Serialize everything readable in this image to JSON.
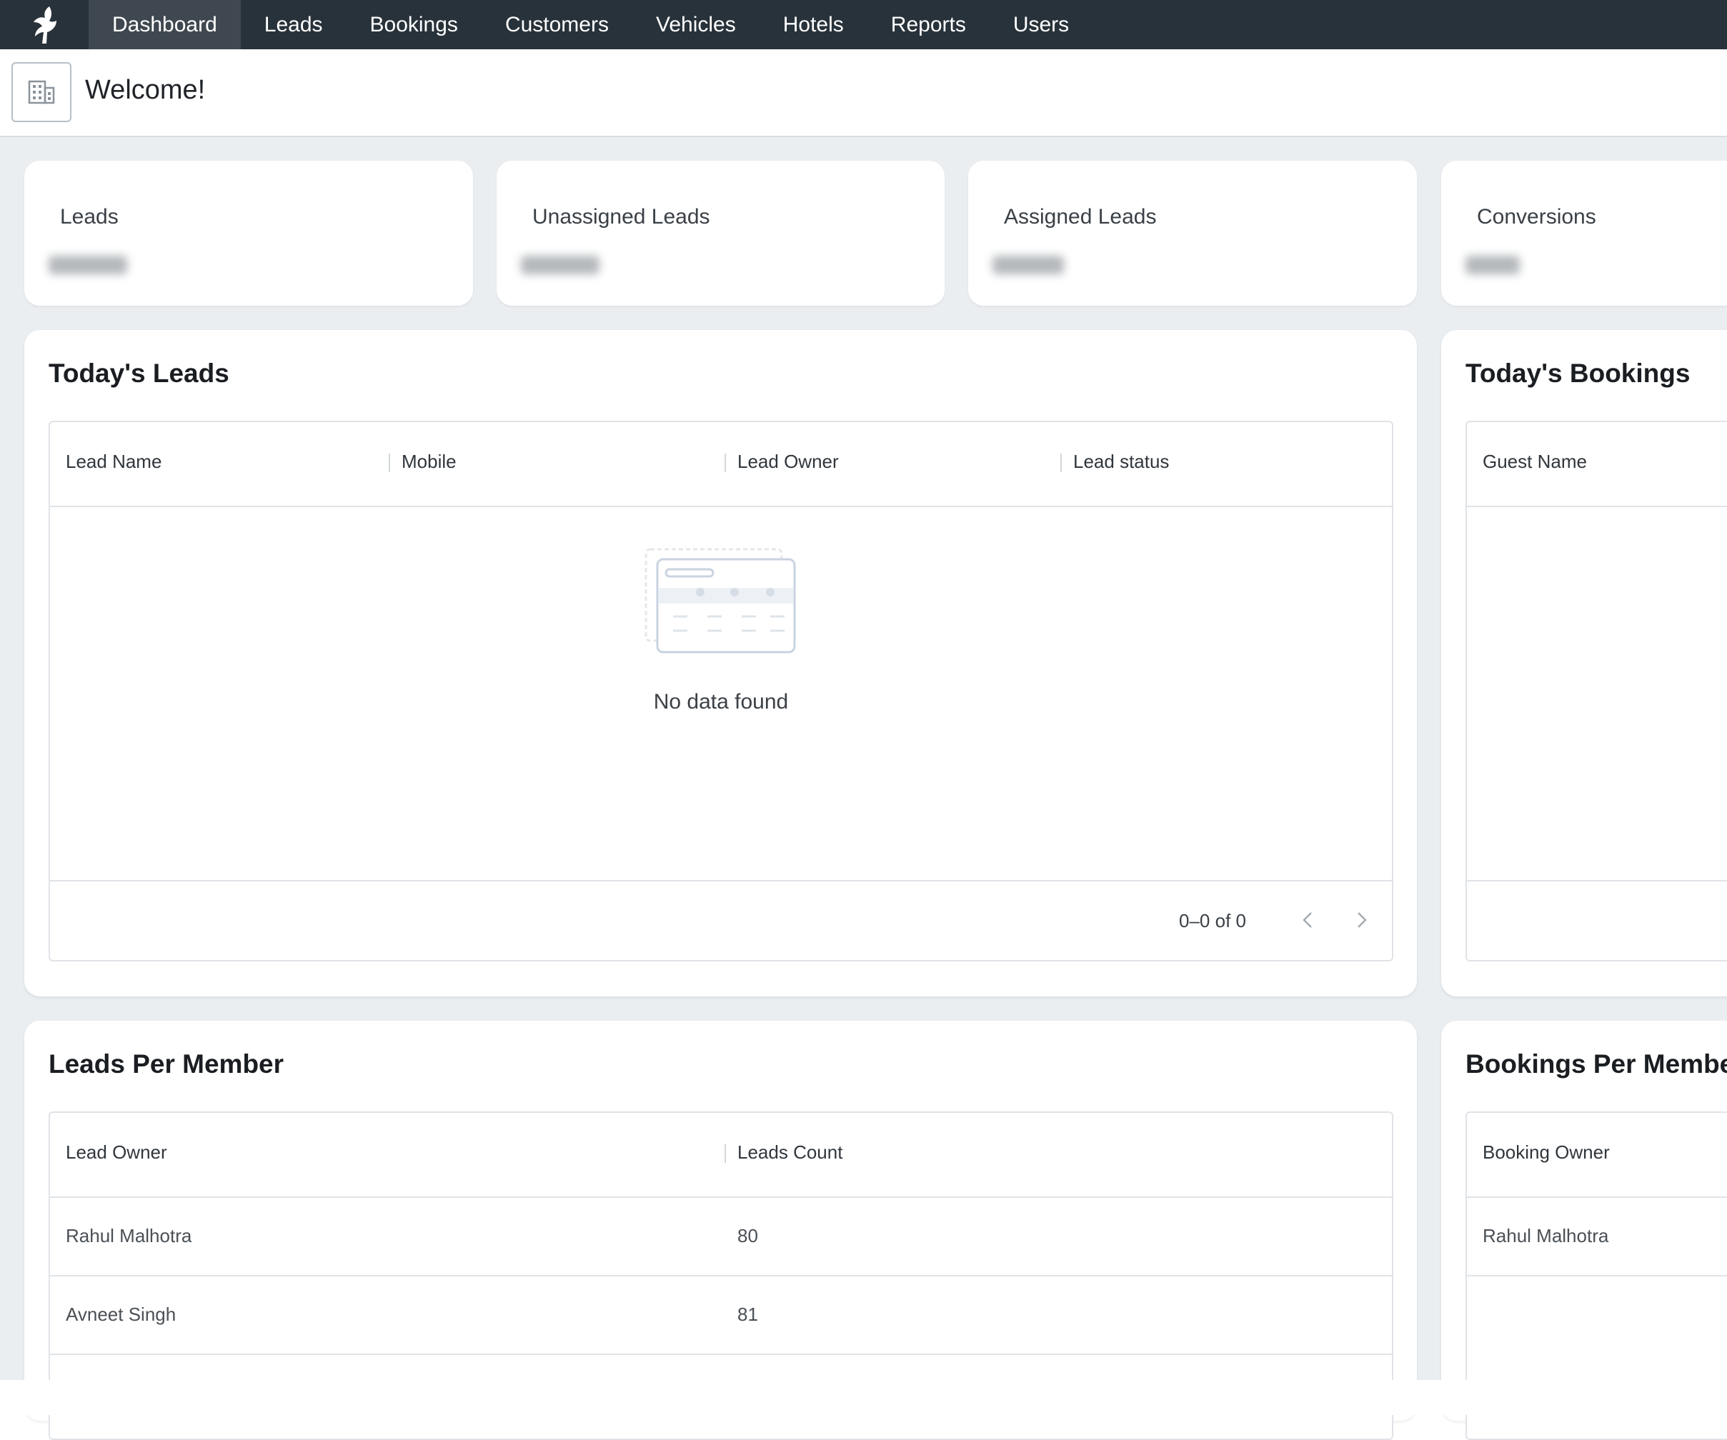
{
  "nav": {
    "items": [
      {
        "label": "Dashboard",
        "active": true
      },
      {
        "label": "Leads",
        "active": false
      },
      {
        "label": "Bookings",
        "active": false
      },
      {
        "label": "Customers",
        "active": false
      },
      {
        "label": "Vehicles",
        "active": false
      },
      {
        "label": "Hotels",
        "active": false
      },
      {
        "label": "Reports",
        "active": false
      },
      {
        "label": "Users",
        "active": false
      }
    ],
    "logo_icon": "bird-logo-icon"
  },
  "header": {
    "title": "Welcome!",
    "icon": "building-icon"
  },
  "stats": [
    {
      "label": "Leads"
    },
    {
      "label": "Unassigned Leads"
    },
    {
      "label": "Assigned Leads"
    },
    {
      "label": "Conversions"
    }
  ],
  "todays_leads": {
    "title": "Today's Leads",
    "columns": [
      "Lead Name",
      "Mobile",
      "Lead Owner",
      "Lead status"
    ],
    "empty_text": "No data found",
    "pagination": "0–0 of 0"
  },
  "todays_bookings": {
    "title": "Today's Bookings",
    "columns": [
      "Guest Name"
    ]
  },
  "leads_per_member": {
    "title": "Leads Per Member",
    "columns": [
      "Lead Owner",
      "Leads Count"
    ],
    "rows": [
      {
        "owner": "Rahul Malhotra",
        "count": "80"
      },
      {
        "owner": "Avneet Singh",
        "count": "81"
      }
    ]
  },
  "bookings_per_member": {
    "title": "Bookings Per Membe",
    "columns": [
      "Booking Owner"
    ],
    "rows": [
      {
        "owner": "Rahul Malhotra"
      }
    ]
  },
  "colors": {
    "nav_bg": "#28323a",
    "nav_active": "#3f4850",
    "content_bg": "#ebeef1"
  }
}
